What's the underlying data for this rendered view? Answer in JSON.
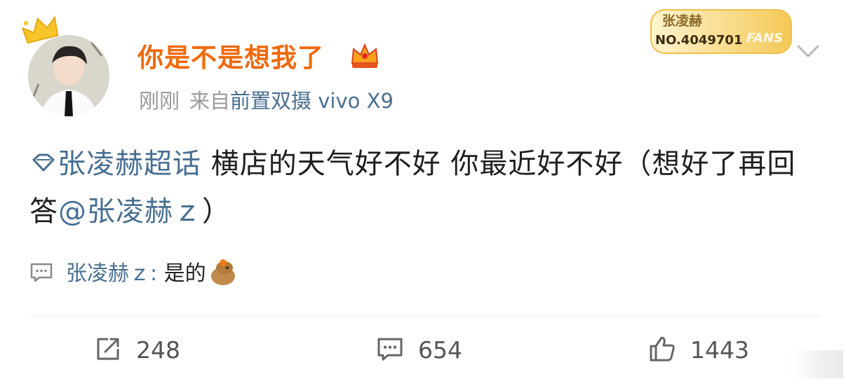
{
  "post": {
    "author": "你是不是想我了",
    "time": "刚刚",
    "source_prefix": "来自",
    "device": "前置双摄 vivo X9",
    "topic": "张凌赫超话",
    "body_text": " 横店的天气好不好 你最近好不好（想好了再回答",
    "mention": "@张凌赫ｚ",
    "body_end": "）"
  },
  "fan_badge": {
    "name": "张凌赫",
    "number": "NO.4049701",
    "label": "FANS"
  },
  "comment_preview": {
    "author": "张凌赫ｚ:",
    "text": "是的"
  },
  "actions": {
    "repost_count": "248",
    "comment_count": "654",
    "like_count": "1443"
  },
  "colors": {
    "username": "#ef6a0d",
    "link": "#486f92",
    "meta": "#9a9a9a"
  },
  "icons": [
    "crown-icon",
    "vip-crown-icon",
    "chevron-down-icon",
    "topic-diamond-icon",
    "comment-icon",
    "repost-icon",
    "like-icon"
  ]
}
